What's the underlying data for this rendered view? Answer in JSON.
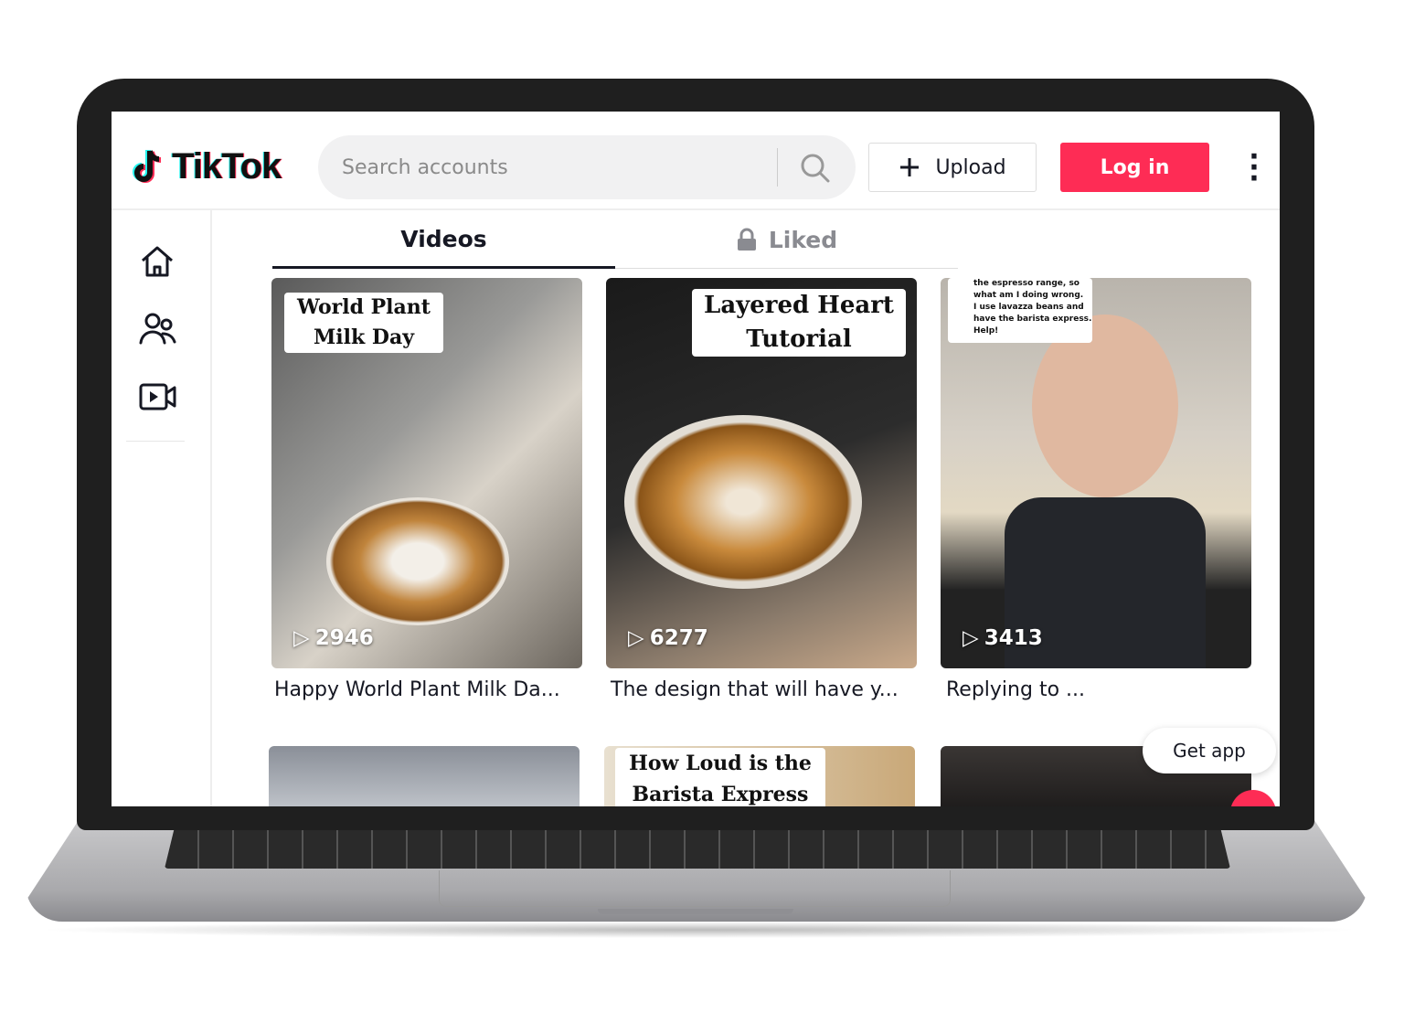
{
  "app": {
    "name": "TikTok",
    "brand_color": "#fe2c55",
    "accent_cyan": "#25f4ee"
  },
  "header": {
    "search_placeholder": "Search accounts",
    "upload_label": "Upload",
    "login_label": "Log in"
  },
  "sidebar": {
    "items": [
      {
        "icon": "home-icon"
      },
      {
        "icon": "following-icon"
      },
      {
        "icon": "live-video-icon"
      }
    ]
  },
  "tabs": [
    {
      "label": "Videos",
      "active": true
    },
    {
      "label": "Liked",
      "active": false,
      "icon": "lock-icon"
    }
  ],
  "videos": [
    {
      "overlay": "World Plant Milk Day",
      "overlay_l1": "World Plant",
      "overlay_l2": "Milk Day",
      "plays": "2946",
      "caption": "Happy World Plant Milk Da..."
    },
    {
      "overlay_l1": "Layered Heart",
      "overlay_l2": "Tutorial",
      "plays": "6277",
      "caption": "The design that will have y..."
    },
    {
      "overlay_l1": "the espresso range, so",
      "overlay_l2": "what am I doing wrong.",
      "overlay_l3": "I use lavazza beans and",
      "overlay_l4": "have the barista express.",
      "overlay_l5": "Help!",
      "plays": "3413",
      "caption": "Replying to ..."
    }
  ],
  "videos_row2": [
    {
      "overlay": ""
    },
    {
      "overlay_l1": "How Loud is the",
      "overlay_l2": "Barista Express"
    },
    {
      "overlay": ""
    }
  ],
  "get_app_label": "Get app"
}
